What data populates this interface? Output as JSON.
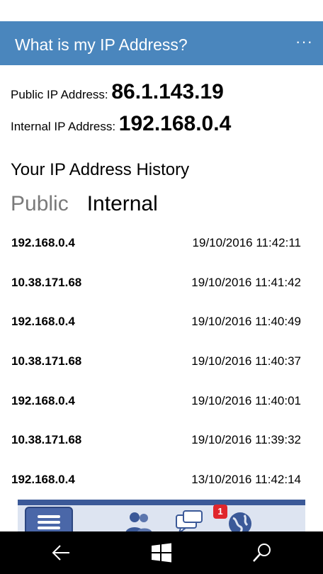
{
  "app": {
    "title": "What is my IP Address?",
    "more_label": "···"
  },
  "ip_info": {
    "public_label": "Public IP Address: ",
    "public_value": "86.1.143.19",
    "internal_label": "Internal IP Address: ",
    "internal_value": "192.168.0.4"
  },
  "history": {
    "heading": "Your IP Address History",
    "tabs": [
      {
        "label": "Public",
        "active": false
      },
      {
        "label": "Internal",
        "active": true
      }
    ],
    "rows": [
      {
        "ip": "192.168.0.4",
        "time": "19/10/2016 11:42:11"
      },
      {
        "ip": "10.38.171.68",
        "time": "19/10/2016 11:41:42"
      },
      {
        "ip": "192.168.0.4",
        "time": "19/10/2016 11:40:49"
      },
      {
        "ip": "10.38.171.68",
        "time": "19/10/2016 11:40:37"
      },
      {
        "ip": "192.168.0.4",
        "time": "19/10/2016 11:40:01"
      },
      {
        "ip": "10.38.171.68",
        "time": "19/10/2016 11:39:32"
      },
      {
        "ip": "192.168.0.4",
        "time": "13/10/2016 11:42:14"
      }
    ]
  },
  "ad": {
    "notification_count": "1"
  },
  "colors": {
    "titlebar": "#4a86bd",
    "inactive_tab": "#7a7a7a",
    "navbar": "#000000"
  },
  "navbar": {
    "icons": [
      "back-arrow-icon",
      "windows-logo-icon",
      "search-icon"
    ]
  }
}
